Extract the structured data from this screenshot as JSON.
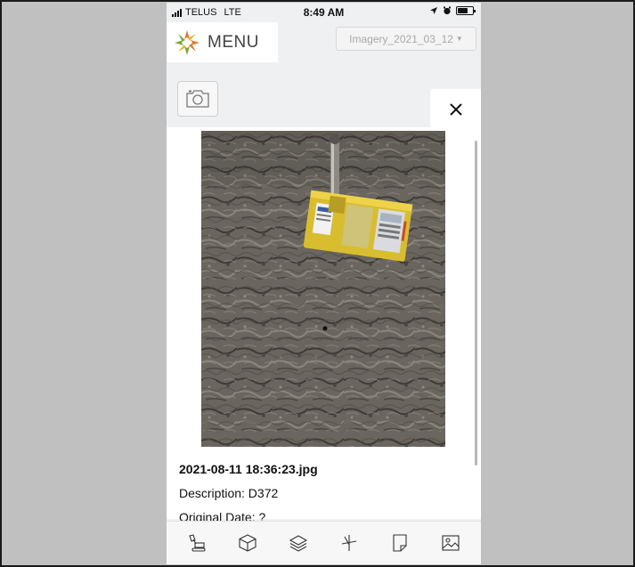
{
  "status_bar": {
    "carrier": "TELUS",
    "network": "LTE",
    "time": "8:49 AM"
  },
  "header": {
    "menu_label": "MENU",
    "imagery_selected": "Imagery_2021_03_12"
  },
  "photo_detail": {
    "filename": "2021-08-11 18:36:23.jpg",
    "description": "Description: D372",
    "original_date": "Original Date: ?"
  },
  "toolbar": {
    "icons": [
      "excavator-icon",
      "cube-icon",
      "layers-icon",
      "measure-icon",
      "note-icon",
      "image-icon"
    ]
  },
  "colors": {
    "logo_orange": "#e07a2c",
    "logo_green": "#7aa63a",
    "logo_yellow": "#e8b52a",
    "gauge_yellow": "#e3c83a"
  }
}
